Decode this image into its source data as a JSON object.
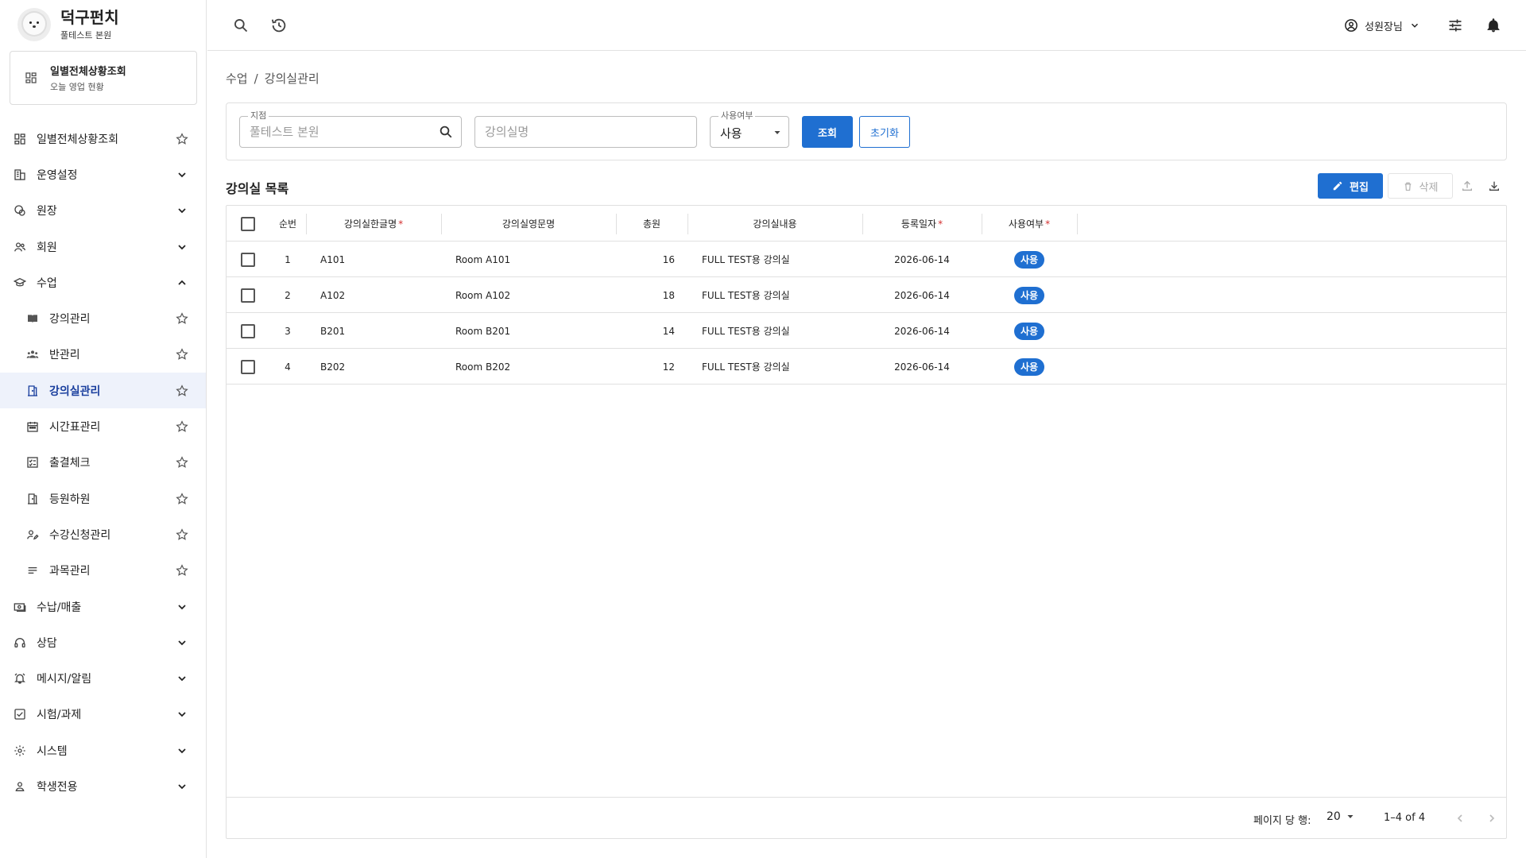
{
  "brand": {
    "name": "덕구펀치",
    "branch": "풀테스트 본원"
  },
  "daily_card": {
    "title": "일별전체상황조회",
    "subtitle": "오늘 영업 현황"
  },
  "sidebar": {
    "items": [
      {
        "label": "일별전체상황조회",
        "icon": "dashboard-icon",
        "right": "star"
      },
      {
        "label": "운영설정",
        "icon": "building-icon",
        "right": "chevron-down"
      },
      {
        "label": "원장",
        "icon": "palette-icon",
        "right": "chevron-down"
      },
      {
        "label": "회원",
        "icon": "users-icon",
        "right": "chevron-down"
      },
      {
        "label": "수업",
        "icon": "school-icon",
        "right": "chevron-up"
      },
      {
        "label": "강의관리",
        "icon": "book-icon",
        "right": "star",
        "sub": true
      },
      {
        "label": "반관리",
        "icon": "group-icon",
        "right": "star",
        "sub": true
      },
      {
        "label": "강의실관리",
        "icon": "door-icon",
        "right": "star",
        "sub": true,
        "active": true
      },
      {
        "label": "시간표관리",
        "icon": "calendar-icon",
        "right": "star",
        "sub": true
      },
      {
        "label": "출결체크",
        "icon": "checklist-icon",
        "right": "star",
        "sub": true
      },
      {
        "label": "등원하원",
        "icon": "door-icon",
        "right": "star",
        "sub": true
      },
      {
        "label": "수강신청관리",
        "icon": "person-edit-icon",
        "right": "star",
        "sub": true
      },
      {
        "label": "과목관리",
        "icon": "list-icon",
        "right": "star",
        "sub": true
      },
      {
        "label": "수납/매출",
        "icon": "money-icon",
        "right": "chevron-down"
      },
      {
        "label": "상담",
        "icon": "headset-icon",
        "right": "chevron-down"
      },
      {
        "label": "메시지/알림",
        "icon": "alarm-icon",
        "right": "chevron-down"
      },
      {
        "label": "시험/과제",
        "icon": "checkbox-icon",
        "right": "chevron-down"
      },
      {
        "label": "시스템",
        "icon": "gear-icon",
        "right": "chevron-down"
      },
      {
        "label": "학생전용",
        "icon": "person-icon",
        "right": "chevron-down"
      }
    ]
  },
  "topbar": {
    "user_name": "성원장님"
  },
  "breadcrumb": {
    "parent": "수업",
    "separator": "/",
    "current": "강의실관리"
  },
  "filters": {
    "branch_legend": "지점",
    "branch_placeholder": "풀테스트 본원",
    "room_placeholder": "강의실명",
    "usage_legend": "사용여부",
    "usage_value": "사용",
    "search_label": "조회",
    "reset_label": "초기화"
  },
  "list": {
    "title": "강의실 목록",
    "edit_label": "편집",
    "delete_label": "삭제",
    "columns": [
      {
        "label": "순번",
        "required": false
      },
      {
        "label": "강의실한글명",
        "required": true
      },
      {
        "label": "강의실영문명",
        "required": false
      },
      {
        "label": "총원",
        "required": false
      },
      {
        "label": "강의실내용",
        "required": false
      },
      {
        "label": "등록일자",
        "required": true
      },
      {
        "label": "사용여부",
        "required": true
      }
    ],
    "required_mark": "*",
    "rows": [
      {
        "no": "1",
        "name_ko": "A101",
        "name_en": "Room A101",
        "capacity": "16",
        "desc": "FULL TEST용 강의실",
        "date": "2026-06-14",
        "status": "사용"
      },
      {
        "no": "2",
        "name_ko": "A102",
        "name_en": "Room A102",
        "capacity": "18",
        "desc": "FULL TEST용 강의실",
        "date": "2026-06-14",
        "status": "사용"
      },
      {
        "no": "3",
        "name_ko": "B201",
        "name_en": "Room B201",
        "capacity": "14",
        "desc": "FULL TEST용 강의실",
        "date": "2026-06-14",
        "status": "사용"
      },
      {
        "no": "4",
        "name_ko": "B202",
        "name_en": "Room B202",
        "capacity": "12",
        "desc": "FULL TEST용 강의실",
        "date": "2026-06-14",
        "status": "사용"
      }
    ]
  },
  "pagination": {
    "rows_per_page_label": "페이지 당 행:",
    "rows_per_page": "20",
    "range": "1–4 of 4"
  },
  "colors": {
    "primary": "#1f6fd1",
    "active_bg": "#eef2fb",
    "active_text": "#1a3f9e",
    "required": "#d32f2f"
  }
}
